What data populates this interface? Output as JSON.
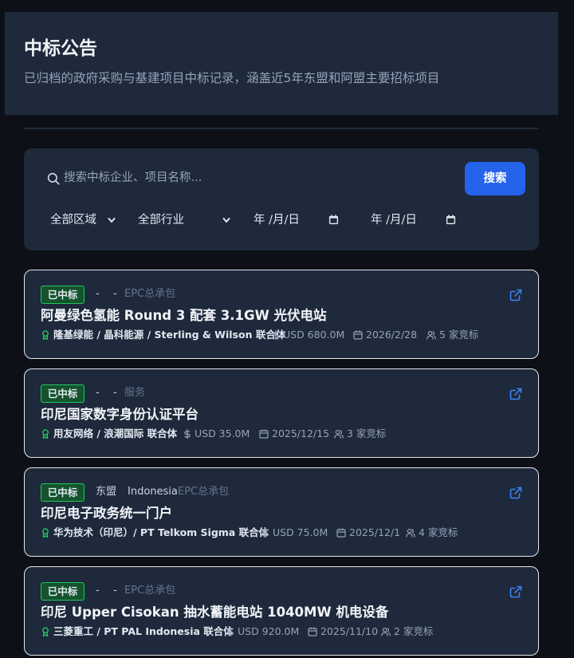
{
  "header": {
    "title": "中标公告",
    "subtitle": "已归档的政府采购与基建项目中标记录，涵盖近5年东盟和阿盟主要招标项目"
  },
  "search": {
    "placeholder": "搜索中标企业、项目名称...",
    "button_label": "搜索",
    "region_select": "全部区域",
    "industry_select": "全部行业",
    "date_from": "年 /月/日",
    "date_to": "年 /月/日"
  },
  "icons": {
    "search": "search-icon",
    "external": "external-link-icon",
    "winner": "award-icon",
    "amount": "dollar-icon",
    "date": "calendar-icon",
    "bidders": "users-icon"
  },
  "colors": {
    "accent": "#2563eb",
    "badge_bg": "#14532d",
    "badge_border": "#22c55e",
    "winner_icon": "#22c55e",
    "link_icon": "#3b82f6"
  },
  "cards": [
    {
      "status": "已中标",
      "region": "-",
      "country": "-",
      "type": "EPC总承包",
      "title": "阿曼绿色氢能 Round 3 配套 3.1GW 光伏电站",
      "winner": "隆基绿能 / 晶科能源 / Sterling & Wilson 联合体",
      "amount": "USD 680.0M",
      "date": "2026/2/28",
      "bidders": "5 家竞标"
    },
    {
      "status": "已中标",
      "region": "-",
      "country": "-",
      "type": "服务",
      "title": "印尼国家数字身份认证平台",
      "winner": "用友网络 / 浪潮国际 联合体",
      "amount": "USD 35.0M",
      "date": "2025/12/15",
      "bidders": "3 家竞标"
    },
    {
      "status": "已中标",
      "region": "东盟",
      "country": "Indonesia",
      "type": "EPC总承包",
      "title": "印尼电子政务统一门户",
      "winner": "华为技术（印尼）/ PT Telkom Sigma 联合体",
      "amount": "USD 75.0M",
      "date": "2025/12/1",
      "bidders": "4 家竞标"
    },
    {
      "status": "已中标",
      "region": "-",
      "country": "-",
      "type": "EPC总承包",
      "title": "印尼 Upper Cisokan 抽水蓄能电站 1040MW 机电设备",
      "winner": "三菱重工 / PT PAL Indonesia 联合体",
      "amount": "USD 920.0M",
      "date": "2025/11/10",
      "bidders": "2 家竞标"
    }
  ]
}
